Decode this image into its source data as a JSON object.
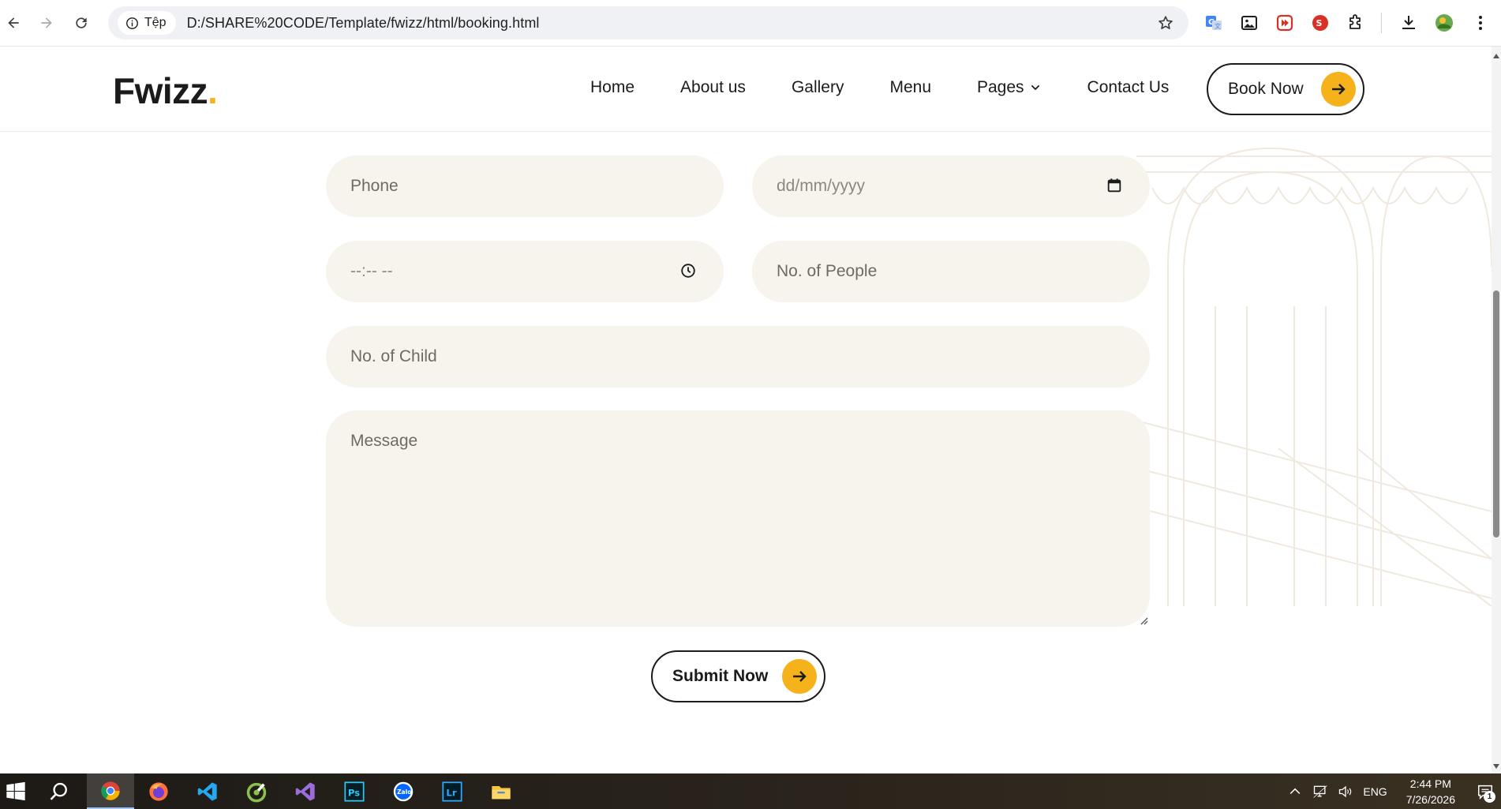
{
  "browser": {
    "site_info_label": "Tệp",
    "url": "D:/SHARE%20CODE/Template/fwizz/html/booking.html"
  },
  "site": {
    "logo_text": "Fwizz",
    "logo_dot": ".",
    "nav": [
      {
        "label": "Home"
      },
      {
        "label": "About us"
      },
      {
        "label": "Gallery"
      },
      {
        "label": "Menu"
      },
      {
        "label": "Pages"
      },
      {
        "label": "Contact Us"
      }
    ],
    "book_button_label": "Book Now",
    "accent_color": "#f6b21b"
  },
  "form": {
    "phone_placeholder": "Phone",
    "date_placeholder": "dd/mm/yyyy",
    "time_placeholder": "--:-- --",
    "people_placeholder": "No. of People",
    "child_placeholder": "No. of Child",
    "message_placeholder": "Message",
    "submit_label": "Submit Now",
    "field_bg": "#f7f4ee"
  },
  "taskbar": {
    "language": "ENG",
    "time": "2:44 PM",
    "date": "7/26/2026",
    "notification_count": "1"
  }
}
